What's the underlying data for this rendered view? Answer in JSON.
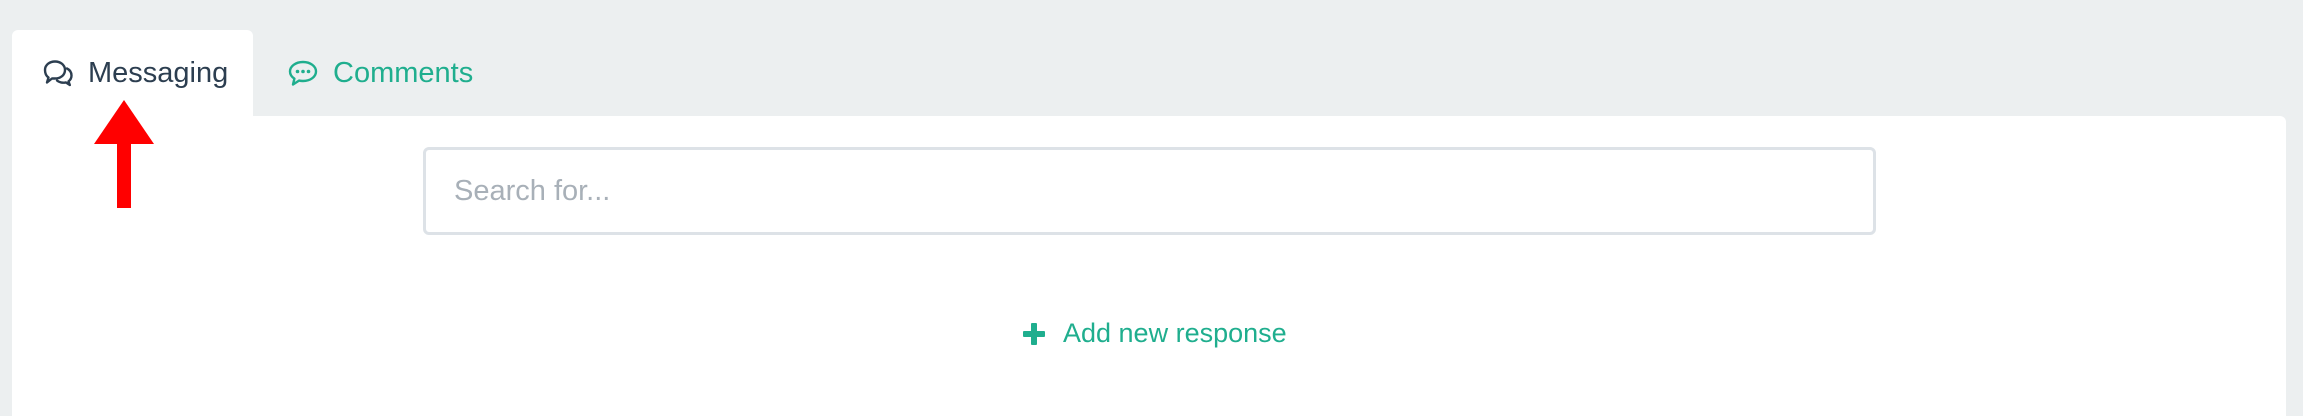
{
  "tabs": [
    {
      "label": "Messaging",
      "icon": "chat-bubbles-icon",
      "active": true
    },
    {
      "label": "Comments",
      "icon": "comment-icon",
      "active": false
    }
  ],
  "search": {
    "placeholder": "Search for...",
    "value": ""
  },
  "actions": {
    "add_new_response_label": "Add new response"
  },
  "colors": {
    "accent": "#1fae8e",
    "text_dark": "#2c3e50",
    "page_bg": "#eceff0",
    "annotation_arrow": "#ff0000"
  }
}
